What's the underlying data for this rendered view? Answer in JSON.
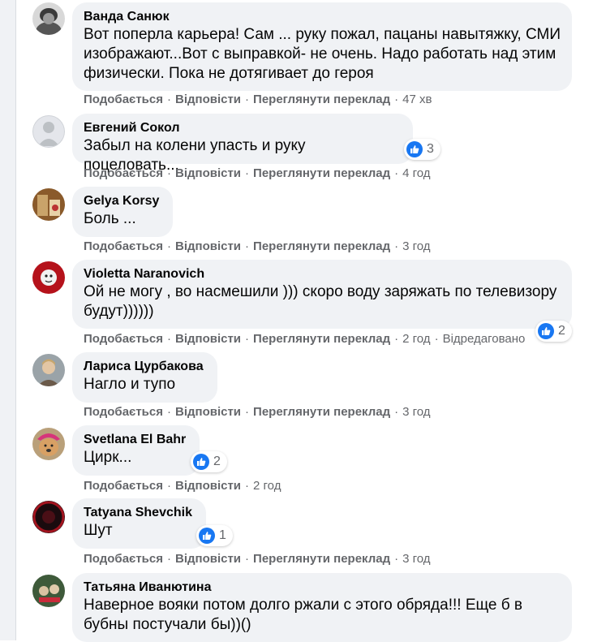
{
  "actions": {
    "like": "Подобається",
    "reply": "Відповісти",
    "translate": "Переглянути переклад",
    "edited": "Відредаговано"
  },
  "comments": [
    {
      "author": "Ванда Санюк",
      "text": "Вот поперла карьера! Сам ... руку пожал, пацаны навытяжку, СМИ изображают...Вот с выправкой- не очень. Надо работать над этим физически. Пока не дотягивает до героя",
      "time": "47 хв"
    },
    {
      "author": "Евгений Сокол",
      "text": "Забыл на колени упасть и руку поцеловать...",
      "time": "4 год",
      "reactions": "3"
    },
    {
      "author": "Gelya Korsy",
      "text": "Боль ...",
      "time": "3 год"
    },
    {
      "author": "Violetta Naranovich",
      "text": "Ой не могу , во насмешили ))) скоро воду заряжать по телевизору будут))))))",
      "time": "2 год",
      "reactions": "2"
    },
    {
      "author": "Лариса Цурбакова",
      "text": "Нагло и тупо",
      "time": "3 год"
    },
    {
      "author": "Svetlana El Bahr",
      "text": "Цирк...",
      "time": "2 год",
      "reactions": "2"
    },
    {
      "author": "Tatyana Shevchik",
      "text": "Шут",
      "time": "3 год",
      "reactions": "1"
    },
    {
      "author": "Татьяна Иванютина",
      "text": "Наверное вояки потом долго ржали с этого обряда!!! Еще б в бубны постучали бы))()"
    }
  ],
  "colors": {
    "like": "#1877f2",
    "bubble": "#f0f2f5",
    "meta": "#65676b"
  }
}
